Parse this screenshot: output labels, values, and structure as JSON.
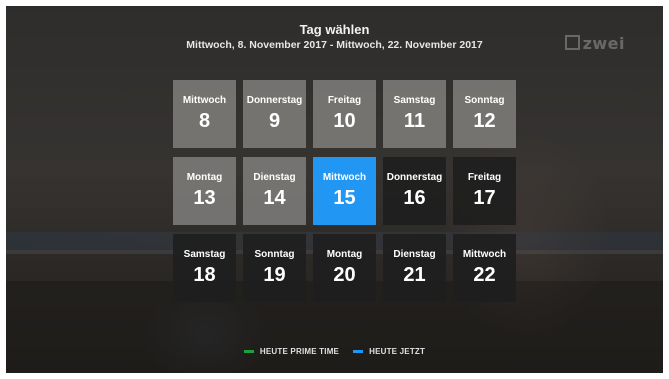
{
  "header": {
    "title": "Tag wählen",
    "subtitle": "Mittwoch, 8. November 2017 - Mittwoch, 22. November 2017"
  },
  "channel_logo": {
    "text": "zwei",
    "icon": "channel-logo-icon"
  },
  "days": [
    {
      "weekday": "Mittwoch",
      "date": "8",
      "state": "past"
    },
    {
      "weekday": "Donnerstag",
      "date": "9",
      "state": "past"
    },
    {
      "weekday": "Freitag",
      "date": "10",
      "state": "past"
    },
    {
      "weekday": "Samstag",
      "date": "11",
      "state": "past"
    },
    {
      "weekday": "Sonntag",
      "date": "12",
      "state": "past"
    },
    {
      "weekday": "Montag",
      "date": "13",
      "state": "past"
    },
    {
      "weekday": "Dienstag",
      "date": "14",
      "state": "past"
    },
    {
      "weekday": "Mittwoch",
      "date": "15",
      "state": "today"
    },
    {
      "weekday": "Donnerstag",
      "date": "16",
      "state": "future"
    },
    {
      "weekday": "Freitag",
      "date": "17",
      "state": "future"
    },
    {
      "weekday": "Samstag",
      "date": "18",
      "state": "future"
    },
    {
      "weekday": "Sonntag",
      "date": "19",
      "state": "future"
    },
    {
      "weekday": "Montag",
      "date": "20",
      "state": "future"
    },
    {
      "weekday": "Dienstag",
      "date": "21",
      "state": "future"
    },
    {
      "weekday": "Mittwoch",
      "date": "22",
      "state": "future"
    }
  ],
  "legend": [
    {
      "label": "HEUTE PRIME TIME",
      "color": "#1aa33a"
    },
    {
      "label": "HEUTE JETZT",
      "color": "#2196f3"
    }
  ],
  "colors": {
    "today": "#2196f3",
    "past": "#7a7876",
    "future": "#1e1e1e"
  }
}
